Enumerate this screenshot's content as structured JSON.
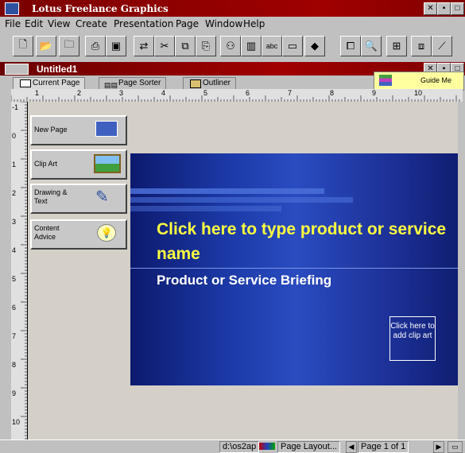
{
  "app": {
    "title": "Lotus Freelance Graphics"
  },
  "menu": [
    "File",
    "Edit",
    "View",
    "Create",
    "Presentation",
    "Page",
    "Window",
    "Help"
  ],
  "document": {
    "title": "Untitled1"
  },
  "tabs": [
    {
      "label": "Current Page",
      "active": true
    },
    {
      "label": "Page Sorter",
      "active": false
    },
    {
      "label": "Outliner",
      "active": false
    }
  ],
  "guide": {
    "label": "Guide Me"
  },
  "ruler": {
    "horizontal": [
      "1",
      "2",
      "3",
      "4",
      "5",
      "6",
      "7",
      "8",
      "9",
      "10"
    ],
    "vertical": [
      "-1",
      "0",
      "1",
      "2",
      "3",
      "4",
      "5",
      "6",
      "7",
      "8",
      "9",
      "10"
    ]
  },
  "sidebar": [
    {
      "label": "New Page",
      "icon": "new-page-icon"
    },
    {
      "label": "Clip Art",
      "icon": "clip-art-icon"
    },
    {
      "label": "Drawing & Text",
      "icon": "drawing-icon"
    },
    {
      "label": "Content Advice",
      "icon": "lightbulb-icon"
    }
  ],
  "slide": {
    "title": "Click here to type product or service name",
    "subtitle": "Product or Service Briefing",
    "clip_placeholder": "Click here to add clip art"
  },
  "status": {
    "path": "d:\\os2ap",
    "layout": "Page Layout...",
    "page": "Page 1 of 1"
  }
}
